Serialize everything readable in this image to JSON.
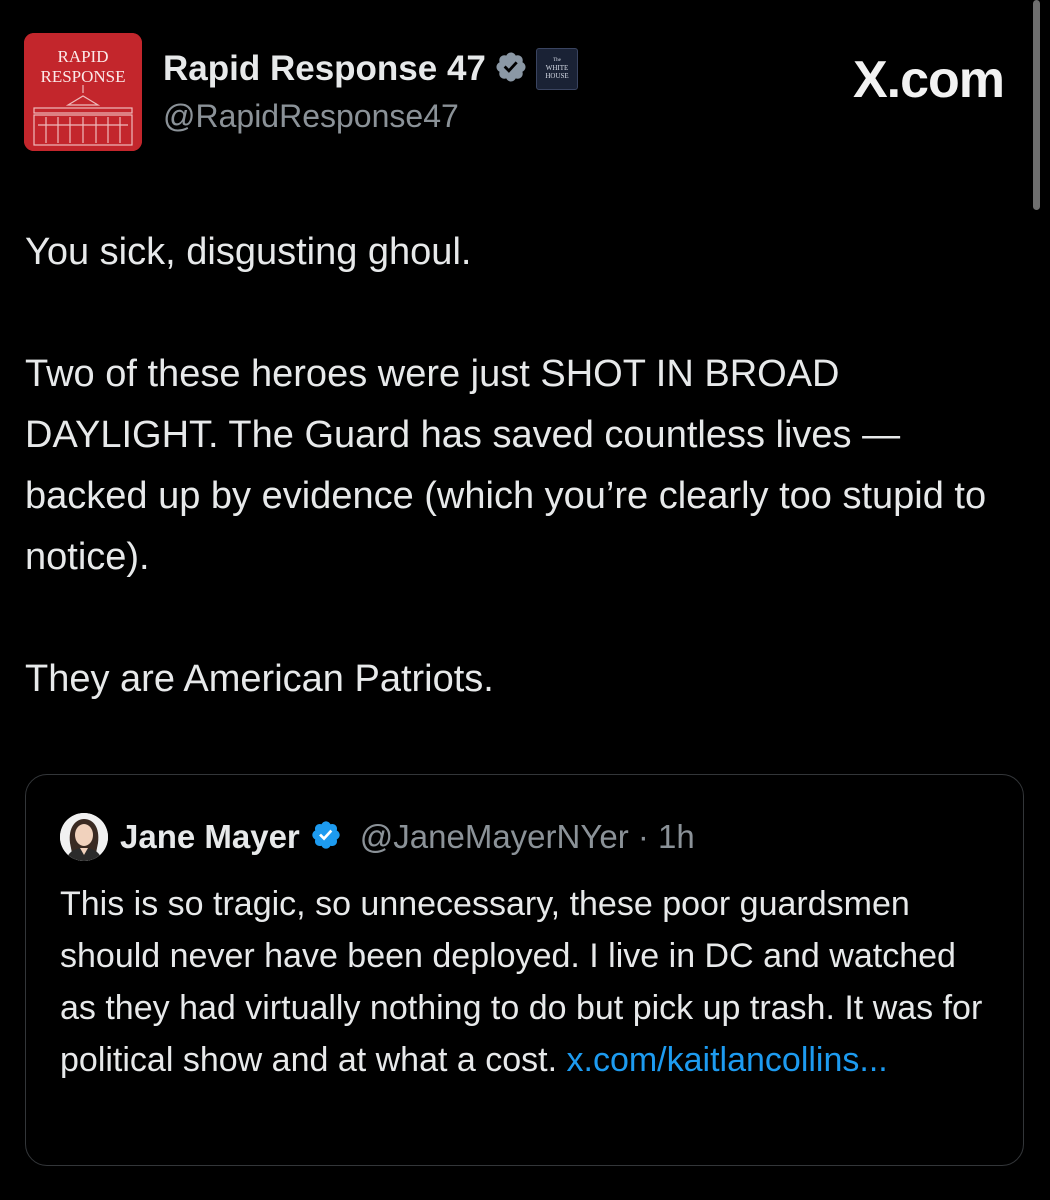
{
  "header": {
    "avatar_lines": [
      "RAPID",
      "RESPONSE"
    ],
    "display_name": "Rapid Response 47",
    "handle": "@RapidResponse47",
    "affiliate_badge_lines": [
      "The",
      "WHITE",
      "HOUSE"
    ],
    "site_mark": "X.com"
  },
  "tweet": {
    "paragraphs": [
      "You sick, disgusting ghoul.",
      "Two of these heroes were just SHOT IN BROAD DAYLIGHT. The Guard has saved countless lives — backed up by evidence (which you’re clearly too stupid to notice).",
      "They are American Patriots."
    ]
  },
  "quote": {
    "display_name": "Jane Mayer",
    "handle": "@JaneMayerNYer",
    "time": "· 1h",
    "text": "This is so tragic, so unnecessary, these poor guardsmen should never have been deployed. I live in DC and watched as they had virtually nothing to do but pick up trash. It was for political show and at what a cost. ",
    "link": "x.com/kaitlancollins..."
  },
  "colors": {
    "background": "#000000",
    "text": "#e7e9ea",
    "secondary_text": "#8b9298",
    "link": "#1d9bf0",
    "verified_badge": "#1d9bf0",
    "avatar_red": "#c3262c"
  },
  "icons": [
    "verified-badge-icon",
    "white-house-affiliate-badge-icon",
    "profile-avatar-icon"
  ]
}
